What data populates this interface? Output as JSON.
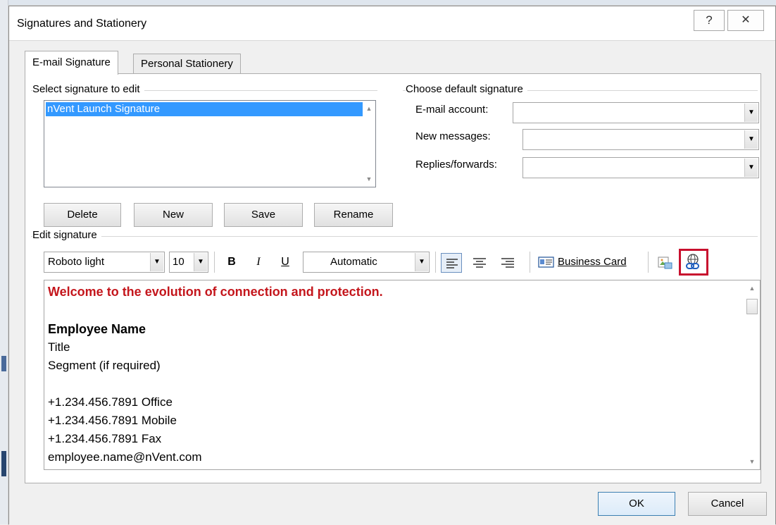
{
  "dialog": {
    "title": "Signatures and Stationery",
    "help_glyph": "?",
    "close_glyph": "✕"
  },
  "tabs": [
    {
      "label": "E-mail Signature",
      "hotkey": "E",
      "active": true
    },
    {
      "label": "Personal Stationery",
      "hotkey": "P",
      "active": false
    }
  ],
  "select_group": {
    "label": "Select signature to edit",
    "signatures": [
      "nVent Launch Signature"
    ],
    "selected_index": 0
  },
  "sig_buttons": {
    "delete": "Delete",
    "new": "New",
    "save": "Save",
    "rename": "Rename"
  },
  "default_group": {
    "label": "Choose default signature",
    "email_account_label": "E-mail account:",
    "email_account_value": "",
    "new_messages_label": "New messages:",
    "new_messages_value": "",
    "replies_label": "Replies/forwards:",
    "replies_value": ""
  },
  "edit_group": {
    "label": "Edit signature",
    "font": "Roboto light",
    "size": "10",
    "bold": "B",
    "italic": "I",
    "underline": "U",
    "color": "Automatic",
    "business_card": "Business Card"
  },
  "signature_text": {
    "headline": "Welcome to the evolution of connection and protection.",
    "name": "Employee Name",
    "title": "Title",
    "segment": "Segment (if required)",
    "office": "+1.234.456.7891 Office",
    "mobile": "+1.234.456.7891 Mobile",
    "fax": "+1.234.456.7891 Fax",
    "email": "employee.name@nVent.com"
  },
  "footer": {
    "ok": "OK",
    "cancel": "Cancel"
  },
  "colors": {
    "selection": "#3399ff",
    "headline_red": "#c4161c",
    "highlight_box": "#c8102e",
    "link_icon_blue": "#1f5fbf"
  }
}
